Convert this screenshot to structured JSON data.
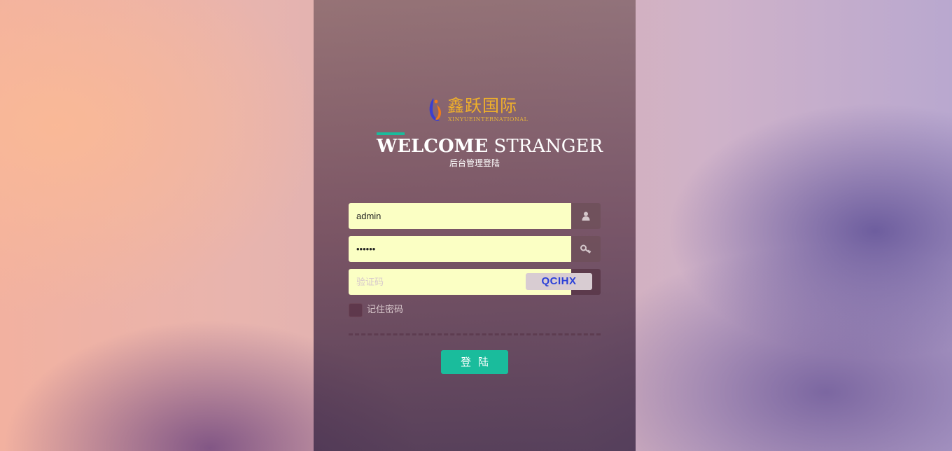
{
  "logo": {
    "text_cn": "鑫跃国际",
    "text_en": "XINYUEINTERNATIONAL",
    "mark_icon": "person-swoosh-icon",
    "colors": {
      "text": "#f0b02a",
      "mark_blue": "#3b3fd0",
      "mark_orange": "#f07a1a"
    }
  },
  "header": {
    "title_bold": "WELCOME",
    "title_light": "STRANGER",
    "subtitle": "后台管理登陆",
    "accent_color": "#1abc9c"
  },
  "form": {
    "username": {
      "value": "admin",
      "icon": "user-icon"
    },
    "password": {
      "value": "••••••",
      "icon": "key-icon"
    },
    "captcha": {
      "placeholder": "验证码",
      "code": "QCIHX"
    },
    "remember_label": "记住密码",
    "remember_checked": false,
    "submit_label": "登陆",
    "button_color": "#1abc9c"
  }
}
